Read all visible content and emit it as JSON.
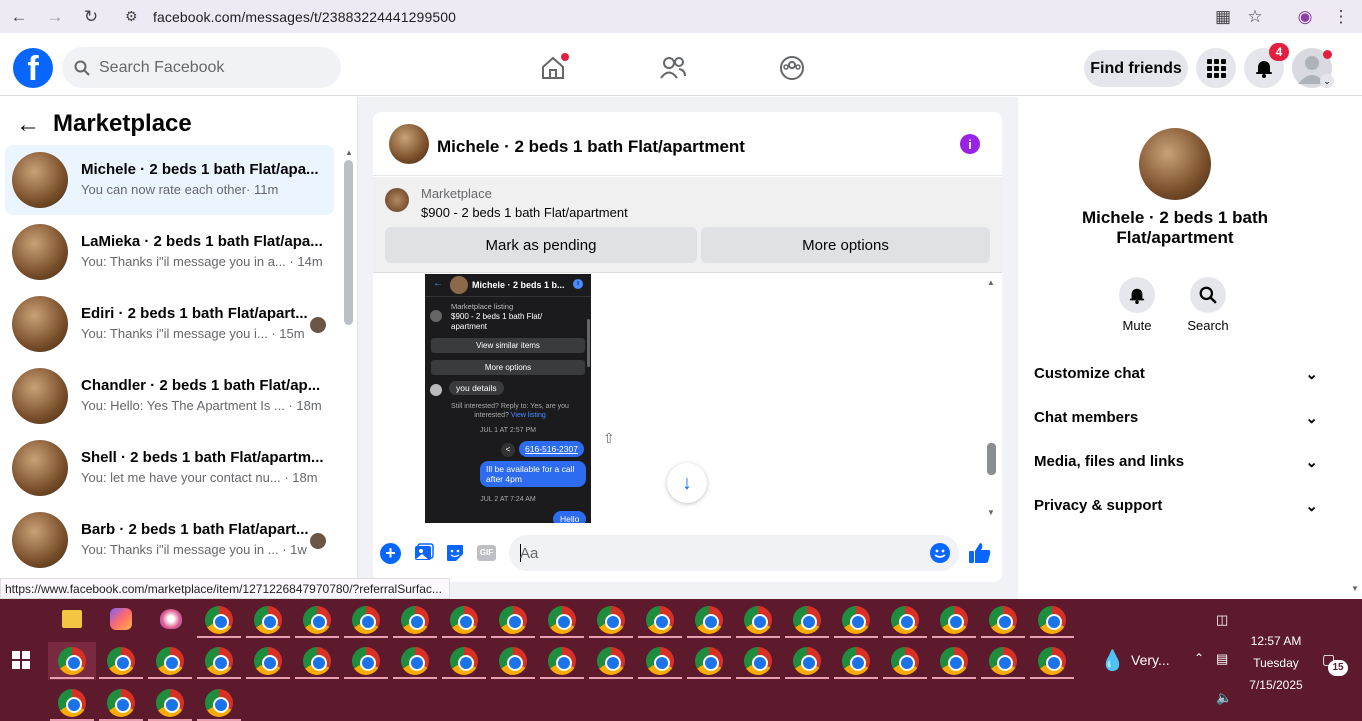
{
  "browser": {
    "url": "facebook.com/messages/t/23883224441299500"
  },
  "fb": {
    "logo": "f",
    "search_placeholder": "Search Facebook",
    "find_friends": "Find friends",
    "notif_count": "4"
  },
  "left": {
    "title": "Marketplace",
    "conversations": [
      {
        "name": "Michele · 2 beds 1 bath Flat/apa...",
        "snippet": "You can now rate each other",
        "time": "· 11m"
      },
      {
        "name": "LaMieka · 2 beds 1 bath Flat/apa...",
        "snippet": "You: Thanks i\"il message you in a...",
        "time": "· 14m"
      },
      {
        "name": "Ediri · 2 beds 1 bath Flat/apart...",
        "snippet": "You: Thanks i\"il message you i...",
        "time": "· 15m"
      },
      {
        "name": "Chandler · 2 beds 1 bath Flat/ap...",
        "snippet": "You: Hello: Yes The Apartment Is ...",
        "time": "· 18m"
      },
      {
        "name": "Shell · 2 beds 1 bath Flat/apartm...",
        "snippet": "You: let me have your contact nu...",
        "time": "· 18m"
      },
      {
        "name": "Barb · 2 beds 1 bath Flat/apart...",
        "snippet": "You: Thanks i\"il message you in ...",
        "time": "· 1w"
      }
    ]
  },
  "chat": {
    "title": "Michele · 2 beds 1 bath Flat/apartment",
    "market_label": "Marketplace",
    "market_price": "$900 - 2 beds 1 bath Flat/apartment",
    "mark_pending": "Mark as pending",
    "more_options": "More options",
    "composer_placeholder": "Aa",
    "shot": {
      "title": "Michele · 2 beds 1 b...",
      "listing_label": "Marketplace listing",
      "listing": "$900 - 2 beds 1 bath Flat/ apartment",
      "view_similar": "View similar items",
      "more_options": "More options",
      "bubble1": "you details",
      "interested": "Still interested? Reply to: Yes, are you interested?",
      "view_listing": "View listing",
      "date1": "JUL 1 AT 2:57 PM",
      "phone": "616-516-2307",
      "msg": "Ill be available for a call after 4pm",
      "date2": "JUL 2 AT 7:24 AM",
      "hello": "Hello"
    }
  },
  "info": {
    "name": "Michele · 2 beds 1 bath Flat/apartment",
    "mute": "Mute",
    "search": "Search",
    "sections": [
      "Customize chat",
      "Chat members",
      "Media, files and links",
      "Privacy & support"
    ]
  },
  "status_url": "https://www.facebook.com/marketplace/item/1271226847970780/?referralSurfac...",
  "taskbar": {
    "weather": "Very...",
    "time": "12:57 AM",
    "day": "Tuesday",
    "date": "7/15/2025",
    "notif": "15"
  }
}
